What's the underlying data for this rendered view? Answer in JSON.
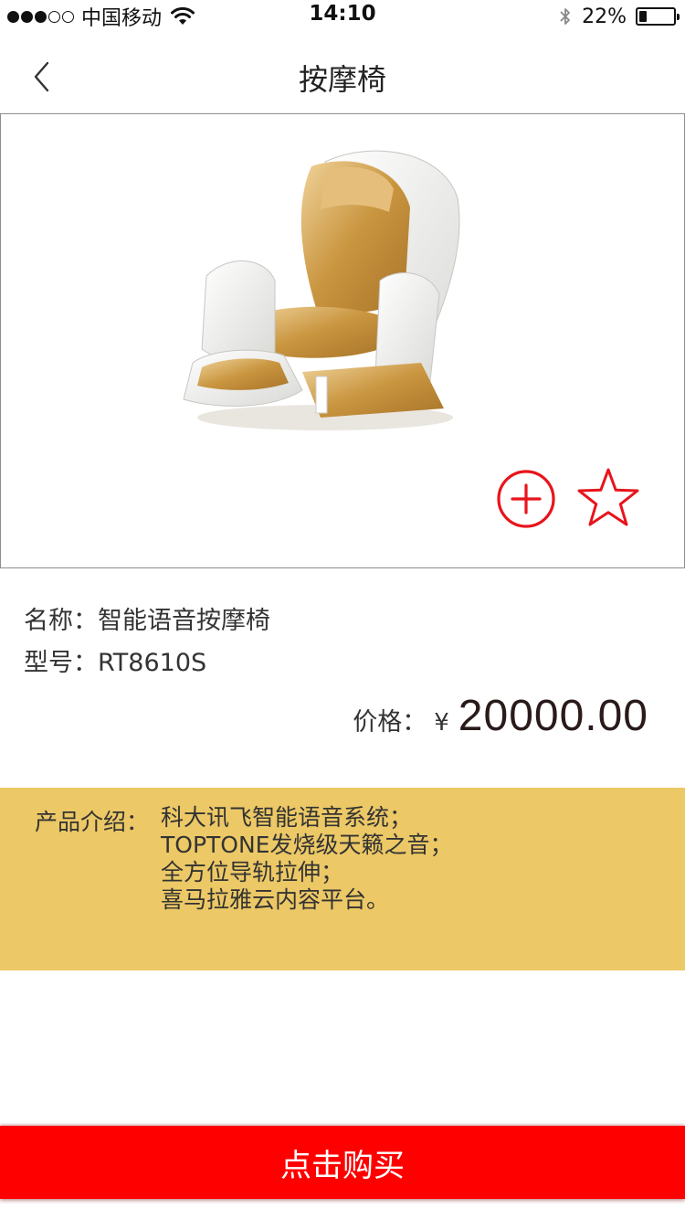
{
  "status_bar": {
    "carrier": "中国移动",
    "time": "14:10",
    "battery_percent": "22%",
    "battery_level": 0.22,
    "icons": [
      "signal-dots-icon",
      "wifi-icon",
      "bluetooth-icon",
      "battery-icon"
    ]
  },
  "nav": {
    "title": "按摩椅",
    "back_icon": "chevron-left-icon"
  },
  "product": {
    "name_label": "名称：",
    "name": "智能语音按摩椅",
    "model_label": "型号：",
    "model": "RT8610S",
    "price_label": "价格：",
    "currency": "¥",
    "price": "20000.00",
    "add_icon": "plus-circle-icon",
    "favorite_icon": "star-outline-icon"
  },
  "intro": {
    "label": "产品介绍：",
    "lines": [
      "科大讯飞智能语音系统；",
      "TOPTONE发烧级天籁之音；",
      "全方位导轨拉伸；",
      "喜马拉雅云内容平台。"
    ]
  },
  "buy_button": {
    "label": "点击购买"
  },
  "colors": {
    "accent_red": "#ff0000",
    "intro_bg": "#ecc866",
    "icon_red": "#e8141b"
  }
}
